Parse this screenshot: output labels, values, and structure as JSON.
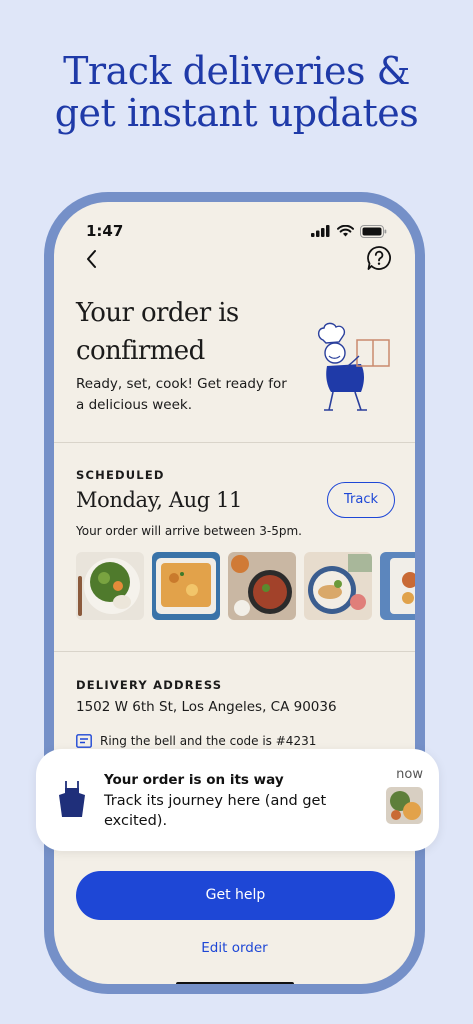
{
  "headline": {
    "line1": "Track deliveries &",
    "line2": "get instant updates"
  },
  "status_bar": {
    "time": "1:47",
    "icons": [
      "signal-icon",
      "wifi-icon",
      "battery-icon"
    ]
  },
  "nav": {
    "back_icon": "chevron-left-icon",
    "help_icon": "question-bubble-icon"
  },
  "confirmation": {
    "title": "Your order is confirmed",
    "subtitle": "Ready, set, cook! Get ready for a delicious week."
  },
  "scheduled": {
    "label": "SCHEDULED",
    "date": "Monday, Aug 11",
    "track_label": "Track",
    "arrival": "Your order will arrive between 3-5pm.",
    "meals": [
      "salad-bowl",
      "baked-casserole",
      "skillet-dish",
      "plated-chicken",
      "sheet-pan-meal"
    ]
  },
  "delivery": {
    "label": "DELIVERY ADDRESS",
    "address": "1502 W 6th St, Los Angeles, CA 90036",
    "note": "Ring the bell and the code is #4231"
  },
  "actions": {
    "help_label": "Get help",
    "edit_label": "Edit order"
  },
  "notification": {
    "title": "Your order is on its way",
    "body": "Track its journey here (and get excited).",
    "time": "now"
  },
  "colors": {
    "background": "#dfe6f8",
    "headline": "#1f3aa8",
    "phone_frame": "#7590c8",
    "screen": "#f3efe7",
    "accent": "#1e47d6"
  }
}
